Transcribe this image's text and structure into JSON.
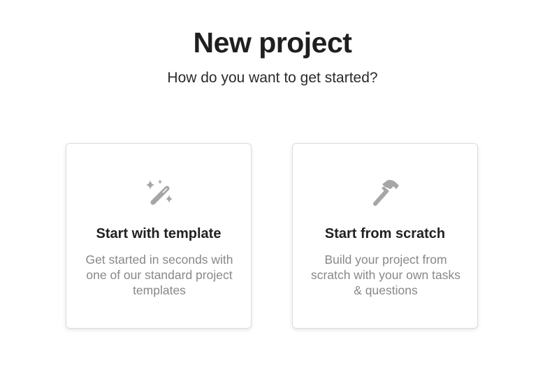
{
  "header": {
    "title": "New project",
    "subtitle": "How do you want to get started?"
  },
  "options": [
    {
      "icon": "magic-wand-icon",
      "title": "Start with template",
      "description": "Get started in seconds with one of our standard project templates"
    },
    {
      "icon": "hammer-icon",
      "title": "Start from scratch",
      "description": "Build your project from scratch with your own tasks & questions"
    }
  ],
  "colors": {
    "icon": "#a6a6a6",
    "description_text": "#888888",
    "card_border": "#dddddd"
  }
}
